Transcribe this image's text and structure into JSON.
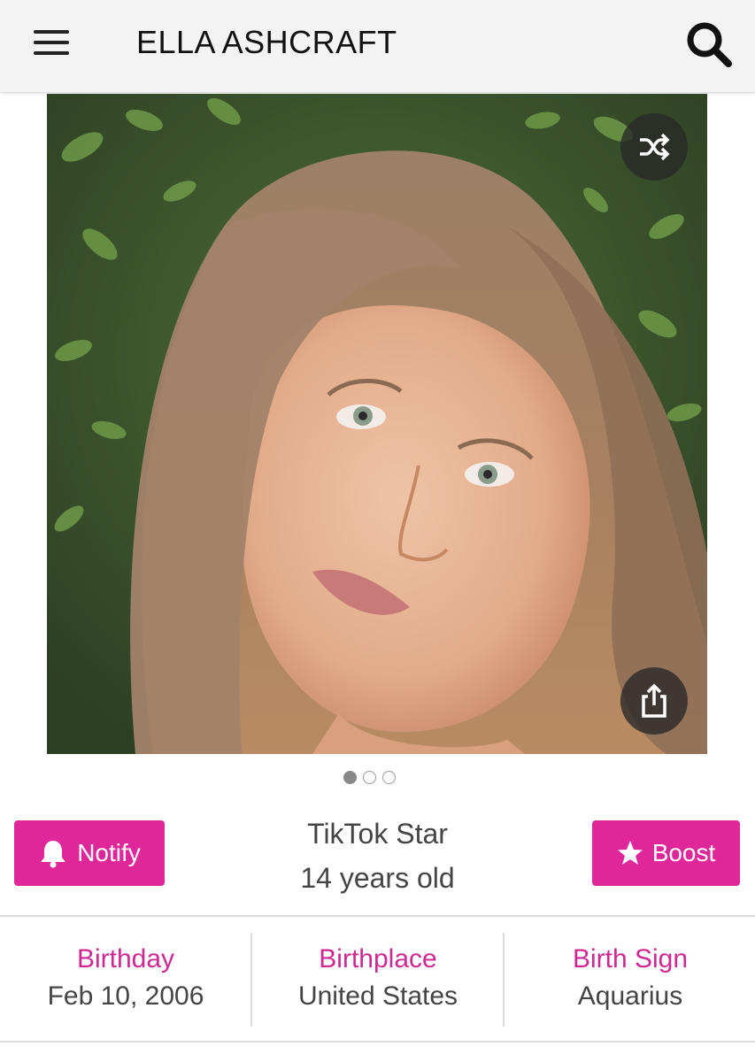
{
  "header": {
    "title": "ELLA ASHCRAFT",
    "menu_icon": "hamburger-menu-icon",
    "search_icon": "search-icon"
  },
  "gallery": {
    "image_count": 3,
    "active_index": 0,
    "shuffle_icon": "shuffle-icon",
    "share_icon": "share-icon"
  },
  "actions": {
    "notify_label": "Notify",
    "notify_icon": "bell-icon",
    "boost_label": "Boost",
    "boost_icon": "star-icon"
  },
  "profile": {
    "profession": "TikTok Star",
    "age": "14 years old"
  },
  "facts": [
    {
      "label": "Birthday",
      "value": "Feb 10, 2006"
    },
    {
      "label": "Birthplace",
      "value": "United States"
    },
    {
      "label": "Birth Sign",
      "value": "Aquarius"
    }
  ],
  "colors": {
    "accent": "#e0279a",
    "fact_label": "#cc2a92",
    "header_bg": "#f3f3f3",
    "text": "#444444"
  }
}
